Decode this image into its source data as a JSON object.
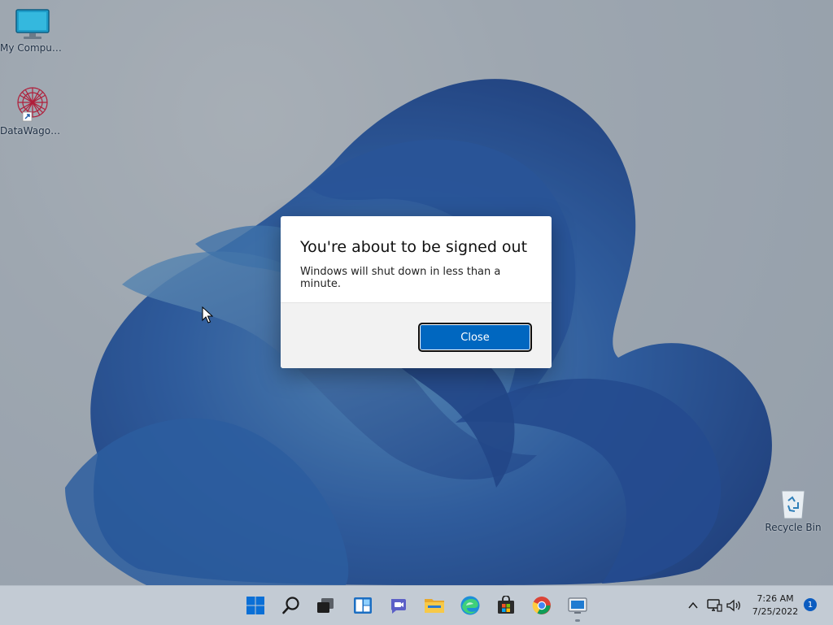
{
  "desktop": {
    "icons": [
      {
        "label": "My Computer",
        "icon": "monitor-icon"
      },
      {
        "label": "DataWagon...",
        "icon": "datawagon-shortcut-icon"
      },
      {
        "label": "Recycle Bin",
        "icon": "recycle-bin-icon"
      }
    ]
  },
  "dialog": {
    "title": "You're about to be signed out",
    "message": "Windows will shut down in less than a minute.",
    "close_label": "Close"
  },
  "taskbar": {
    "apps": [
      {
        "name": "start",
        "icon": "windows-start-icon"
      },
      {
        "name": "search",
        "icon": "search-icon"
      },
      {
        "name": "task-view",
        "icon": "task-view-icon"
      },
      {
        "name": "widgets",
        "icon": "widgets-icon"
      },
      {
        "name": "chat",
        "icon": "teams-chat-icon"
      },
      {
        "name": "file-explorer",
        "icon": "folder-icon"
      },
      {
        "name": "edge",
        "icon": "edge-icon"
      },
      {
        "name": "store",
        "icon": "store-icon"
      },
      {
        "name": "chrome",
        "icon": "chrome-icon"
      },
      {
        "name": "remote-desktop",
        "icon": "remote-desktop-icon"
      }
    ],
    "tray": {
      "time": "7:26 AM",
      "date": "7/25/2022",
      "notification_count": "1"
    }
  },
  "colors": {
    "accent": "#0067c0",
    "bloom_dark": "#0a3a9a",
    "bloom_light": "#2f7fd8"
  }
}
